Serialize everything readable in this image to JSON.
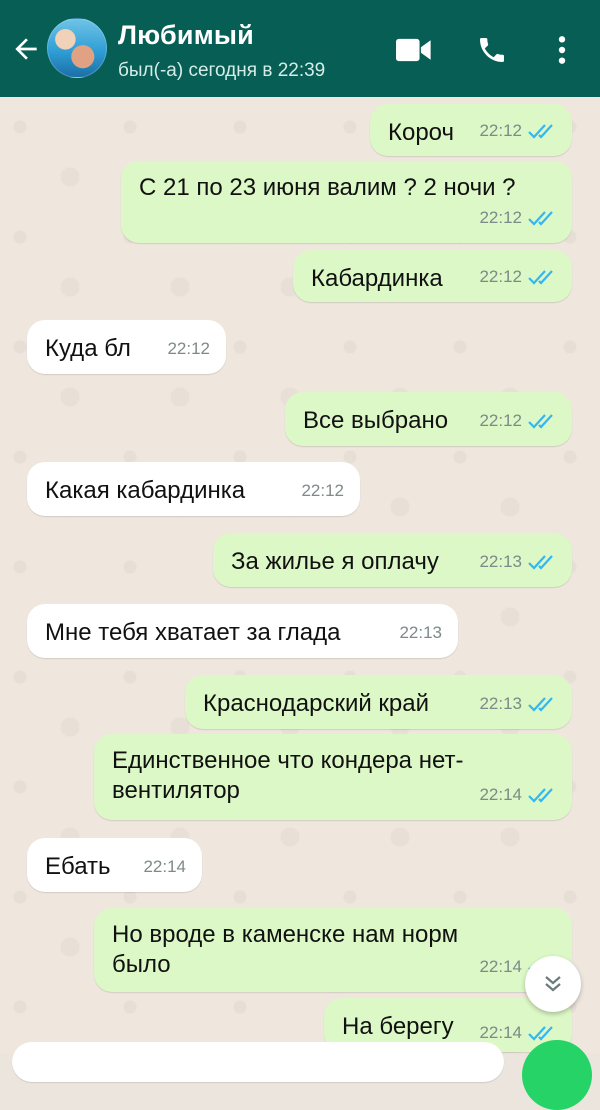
{
  "header": {
    "name": "Любимый",
    "status": "был(-а) сегодня в 22:39"
  },
  "colors": {
    "header": "#075e54",
    "outgoing": "#dcf8c6",
    "incoming": "#ffffff",
    "read_ticks": "#34b7f1"
  },
  "icons": [
    "back-arrow-icon",
    "video-call-icon",
    "phone-icon",
    "more-vertical-icon",
    "double-check-icon",
    "chevron-double-down-icon"
  ],
  "messages": [
    {
      "dir": "out",
      "text": "Короч",
      "time": "22:12"
    },
    {
      "dir": "out",
      "text": "С 21 по 23 июня валим ? 2 ночи ?",
      "time": "22:12"
    },
    {
      "dir": "out",
      "text": "Кабардинка",
      "time": "22:12"
    },
    {
      "dir": "in",
      "text": "Куда бл",
      "time": "22:12"
    },
    {
      "dir": "out",
      "text": "Все выбрано",
      "time": "22:12"
    },
    {
      "dir": "in",
      "text": "Какая кабардинка",
      "time": "22:12"
    },
    {
      "dir": "out",
      "text": "За жилье я оплачу",
      "time": "22:13"
    },
    {
      "dir": "in",
      "text": "Мне тебя хватает за глада",
      "time": "22:13"
    },
    {
      "dir": "out",
      "text": "Краснодарский край",
      "time": "22:13"
    },
    {
      "dir": "out",
      "text": "Единственное что кондера нет-\nвентилятор",
      "time": "22:14"
    },
    {
      "dir": "in",
      "text": "Ебать",
      "time": "22:14"
    },
    {
      "dir": "out",
      "text": "Но вроде в каменске нам норм\nбыло",
      "time": "22:14"
    },
    {
      "dir": "out",
      "text": "На берегу",
      "time": "22:14"
    }
  ]
}
